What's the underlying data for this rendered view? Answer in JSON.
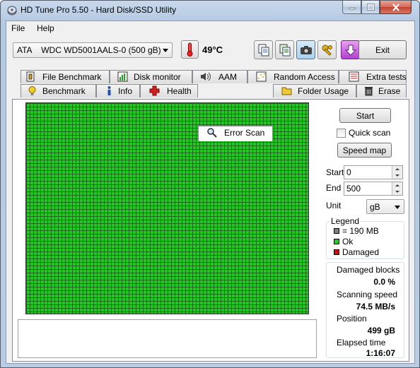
{
  "window": {
    "title": "HD Tune Pro 5.50 - Hard Disk/SSD Utility"
  },
  "menu": {
    "file": "File",
    "help": "Help"
  },
  "toolbar": {
    "drive": "ATA    WDC WD5001AALS-0 (500 gB)",
    "temperature": "49°C",
    "exit_label": "Exit"
  },
  "tabs": {
    "row1": [
      "File Benchmark",
      "Disk monitor",
      "AAM",
      "Random Access",
      "Extra tests"
    ],
    "row2": [
      "Benchmark",
      "Info",
      "Health",
      "Error Scan",
      "Folder Usage",
      "Erase"
    ],
    "selected": "Error Scan"
  },
  "scan": {
    "start_button": "Start",
    "quick_scan_label": "Quick scan",
    "quick_scan_checked": false,
    "speed_map_button": "Speed map",
    "start_label": "Start",
    "start_value": "0",
    "end_label": "End",
    "end_value": "500",
    "unit_label": "Unit",
    "unit_value": "gB"
  },
  "legend": {
    "title": "Legend",
    "block": "= 190 MB",
    "ok": "Ok",
    "damaged": "Damaged",
    "colors": {
      "block": "#808080",
      "ok": "#22c922",
      "damaged": "#d01010"
    }
  },
  "stats": {
    "damaged_blocks_label": "Damaged blocks",
    "damaged_blocks_value": "0.0 %",
    "scanning_speed_label": "Scanning speed",
    "scanning_speed_value": "74.5 MB/s",
    "position_label": "Position",
    "position_value": "499 gB",
    "elapsed_label": "Elapsed time",
    "elapsed_value": "1:16:07"
  }
}
